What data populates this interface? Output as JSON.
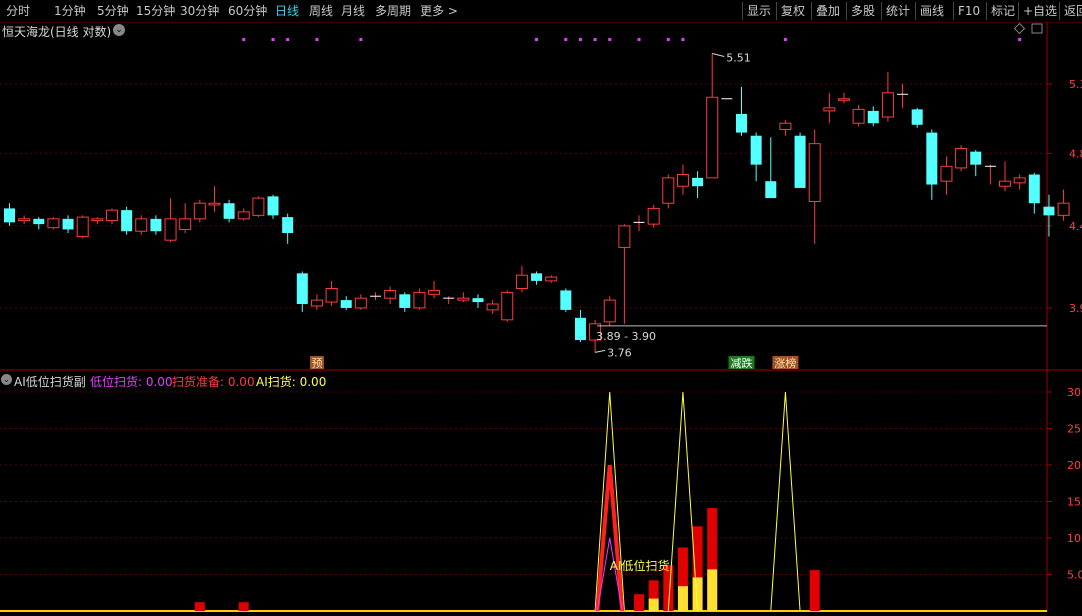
{
  "toolbar": {
    "periods": [
      "分时",
      "1分钟",
      "5分钟",
      "15分钟",
      "30分钟",
      "60分钟",
      "日线",
      "周线",
      "月线",
      "多周期",
      "更多 >"
    ],
    "active_period": "日线",
    "right_buttons": [
      "显示",
      "复权",
      "叠加",
      "多股",
      "统计",
      "画线",
      "F10",
      "标记",
      "+自选",
      "返回"
    ]
  },
  "main_panel": {
    "title": "恒天海龙(日线 对数)",
    "price_labels": [
      {
        "text": "5.3",
        "value": 5.3
      },
      {
        "text": "4.8",
        "value": 4.85
      },
      {
        "text": "4.4",
        "value": 4.42
      },
      {
        "text": "3.9",
        "value": 3.98
      }
    ],
    "high_marker": "5.51",
    "low_marker": "3.76",
    "range_label": "3.89 - 3.90",
    "range_value": 3.895,
    "tags": [
      {
        "text": "预",
        "bg": "#a0522d",
        "fg": "#ffe0a0",
        "x_index": 21
      },
      {
        "text": "减跌",
        "bg": "#1f7a1f",
        "fg": "#ffffff",
        "x_index": 50
      },
      {
        "text": "涨榜",
        "bg": "#a0522d",
        "fg": "#ffe0a0",
        "x_index": 53
      }
    ],
    "magenta_dot_indices": [
      16,
      18,
      19,
      21,
      24,
      36,
      38,
      39,
      40,
      41,
      43,
      45,
      46,
      53,
      69
    ]
  },
  "sub_panel": {
    "title": "AI低位扫货副",
    "legend": [
      {
        "label": "低位扫货: 0.00",
        "color": "#e040fb"
      },
      {
        "label": "扫货准备: 0.00",
        "color": "#ff3b3b"
      },
      {
        "label": "AI扫货: 0.00",
        "color": "#ffff40"
      }
    ],
    "annotation": "AI低位扫货",
    "axis_labels": [
      {
        "text": "30.0",
        "value": 30
      },
      {
        "text": "25.0",
        "value": 25
      },
      {
        "text": "20.0",
        "value": 20
      },
      {
        "text": "15.0",
        "value": 15
      },
      {
        "text": "10.0",
        "value": 10
      },
      {
        "text": "5.0",
        "value": 5
      }
    ]
  },
  "colors": {
    "up": "#ff3b3b",
    "down": "#54ffff",
    "grid": "#5a0000",
    "axis": "#a00000"
  },
  "chart_data": {
    "type": "candlestick",
    "scale": "log",
    "ylim": [
      3.7,
      5.62
    ],
    "candles": [
      [
        4.52,
        4.44,
        4.55,
        4.42
      ],
      [
        4.45,
        4.46,
        4.48,
        4.43
      ],
      [
        4.46,
        4.43,
        4.47,
        4.4
      ],
      [
        4.41,
        4.46,
        4.47,
        4.4
      ],
      [
        4.46,
        4.4,
        4.48,
        4.38
      ],
      [
        4.36,
        4.47,
        4.48,
        4.35
      ],
      [
        4.45,
        4.46,
        4.47,
        4.43
      ],
      [
        4.45,
        4.51,
        4.52,
        4.43
      ],
      [
        4.51,
        4.39,
        4.53,
        4.37
      ],
      [
        4.39,
        4.46,
        4.48,
        4.37
      ],
      [
        4.46,
        4.39,
        4.48,
        4.37
      ],
      [
        4.34,
        4.46,
        4.58,
        4.33
      ],
      [
        4.4,
        4.46,
        4.55,
        4.38
      ],
      [
        4.46,
        4.55,
        4.57,
        4.44
      ],
      [
        4.54,
        4.55,
        4.65,
        4.5
      ],
      [
        4.55,
        4.46,
        4.57,
        4.44
      ],
      [
        4.46,
        4.5,
        4.52,
        4.45
      ],
      [
        4.48,
        4.58,
        4.59,
        4.47
      ],
      [
        4.59,
        4.48,
        4.6,
        4.46
      ],
      [
        4.47,
        4.38,
        4.49,
        4.32
      ],
      [
        4.16,
        4.0,
        4.17,
        3.96
      ],
      [
        3.99,
        4.02,
        4.05,
        3.97
      ],
      [
        4.01,
        4.08,
        4.12,
        3.99
      ],
      [
        4.02,
        3.98,
        4.04,
        3.97
      ],
      [
        3.98,
        4.03,
        4.05,
        3.97
      ],
      [
        4.04,
        4.04,
        4.06,
        4.02
      ],
      [
        4.03,
        4.07,
        4.09,
        4.0
      ],
      [
        4.05,
        3.98,
        4.06,
        3.96
      ],
      [
        3.98,
        4.06,
        4.08,
        3.97
      ],
      [
        4.05,
        4.07,
        4.12,
        4.03
      ],
      [
        4.03,
        4.03,
        4.04,
        4.0
      ],
      [
        4.02,
        4.03,
        4.06,
        4.01
      ],
      [
        4.03,
        4.01,
        4.05,
        3.98
      ],
      [
        3.97,
        4.0,
        4.02,
        3.95
      ],
      [
        3.92,
        4.06,
        4.07,
        3.91
      ],
      [
        4.08,
        4.15,
        4.2,
        4.06
      ],
      [
        4.16,
        4.12,
        4.17,
        4.1
      ],
      [
        4.12,
        4.14,
        4.15,
        4.11
      ],
      [
        4.07,
        3.97,
        4.08,
        3.96
      ],
      [
        3.93,
        3.82,
        3.97,
        3.81
      ],
      [
        3.82,
        3.9,
        3.92,
        3.76
      ],
      [
        3.91,
        4.02,
        4.04,
        3.89
      ],
      [
        4.3,
        4.42,
        4.43,
        3.9
      ],
      [
        4.44,
        4.44,
        4.48,
        4.39
      ],
      [
        4.43,
        4.52,
        4.54,
        4.41
      ],
      [
        4.55,
        4.7,
        4.72,
        4.52
      ],
      [
        4.65,
        4.72,
        4.78,
        4.6
      ],
      [
        4.7,
        4.65,
        4.74,
        4.58
      ],
      [
        4.7,
        5.21,
        5.51,
        4.73
      ],
      [
        5.2,
        5.2,
        5.2,
        5.2
      ],
      [
        5.1,
        4.98,
        5.28,
        4.96
      ],
      [
        4.96,
        4.78,
        4.98,
        4.68
      ],
      [
        4.68,
        4.58,
        4.95,
        4.58
      ],
      [
        5.0,
        5.04,
        5.06,
        4.96
      ],
      [
        4.96,
        4.64,
        4.98,
        4.64
      ],
      [
        4.56,
        4.91,
        5.0,
        4.32
      ],
      [
        5.12,
        5.14,
        5.24,
        5.04
      ],
      [
        5.19,
        5.2,
        5.24,
        5.17
      ],
      [
        5.04,
        5.13,
        5.16,
        5.02
      ],
      [
        5.12,
        5.04,
        5.15,
        5.02
      ],
      [
        5.08,
        5.24,
        5.38,
        5.05
      ],
      [
        5.23,
        5.23,
        5.3,
        5.14
      ],
      [
        5.13,
        5.03,
        5.14,
        5.01
      ],
      [
        4.98,
        4.66,
        5.0,
        4.57
      ],
      [
        4.68,
        4.77,
        4.83,
        4.6
      ],
      [
        4.76,
        4.88,
        4.9,
        4.74
      ],
      [
        4.86,
        4.78,
        4.87,
        4.71
      ],
      [
        4.77,
        4.77,
        4.78,
        4.66
      ],
      [
        4.65,
        4.68,
        4.8,
        4.62
      ],
      [
        4.67,
        4.7,
        4.72,
        4.63
      ],
      [
        4.72,
        4.55,
        4.73,
        4.49
      ],
      [
        4.53,
        4.48,
        4.6,
        4.36
      ],
      [
        4.48,
        4.55,
        4.63,
        4.45
      ]
    ],
    "indicators": {
      "ai_line_peaks": [
        {
          "index": 41,
          "value": 30
        },
        {
          "index": 46,
          "value": 30
        },
        {
          "index": 53,
          "value": 30
        }
      ],
      "red_line_peak": {
        "index": 41,
        "value": 20
      },
      "magenta_line_peak": {
        "index": 41,
        "value": 10
      },
      "red_bars": [
        {
          "index": 13,
          "value": 1.2
        },
        {
          "index": 16,
          "value": 1.2
        },
        {
          "index": 43,
          "value": 2.3
        },
        {
          "index": 44,
          "value": 4.2
        },
        {
          "index": 45,
          "value": 6.3
        },
        {
          "index": 46,
          "value": 8.7
        },
        {
          "index": 47,
          "value": 11.6
        },
        {
          "index": 48,
          "value": 14.1
        },
        {
          "index": 55,
          "value": 5.6
        }
      ],
      "yellow_bars": [
        {
          "index": 44,
          "value": 1.7
        },
        {
          "index": 46,
          "value": 3.4
        },
        {
          "index": 47,
          "value": 4.6
        },
        {
          "index": 48,
          "value": 5.7
        }
      ]
    }
  }
}
